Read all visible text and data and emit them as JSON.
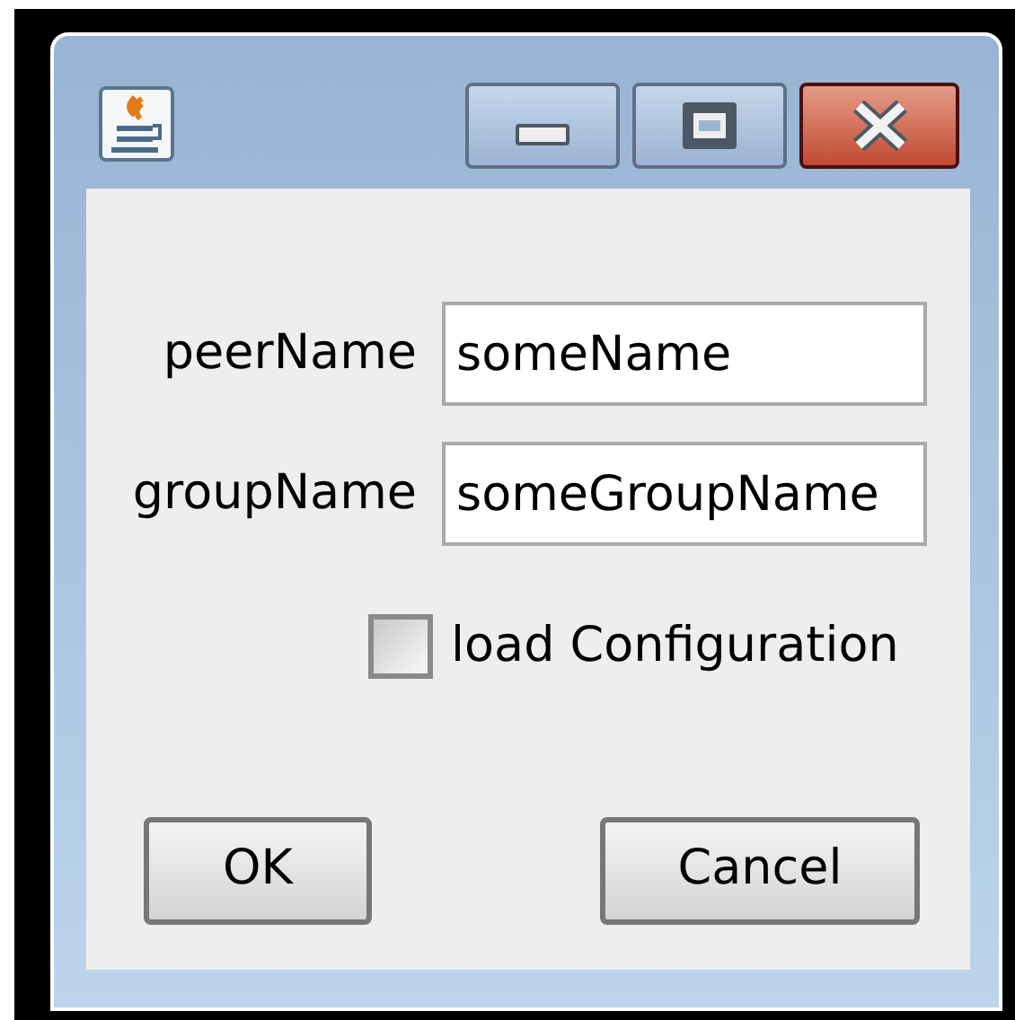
{
  "fields": [
    {
      "label": "peerName",
      "value": "someName"
    },
    {
      "label": "groupName",
      "value": "someGroupName"
    }
  ],
  "checkbox": {
    "label": "load Configuration",
    "checked": false
  },
  "buttons": [
    {
      "label": "OK",
      "kind": "ok"
    },
    {
      "label": "Cancel",
      "kind": "cancel"
    }
  ]
}
